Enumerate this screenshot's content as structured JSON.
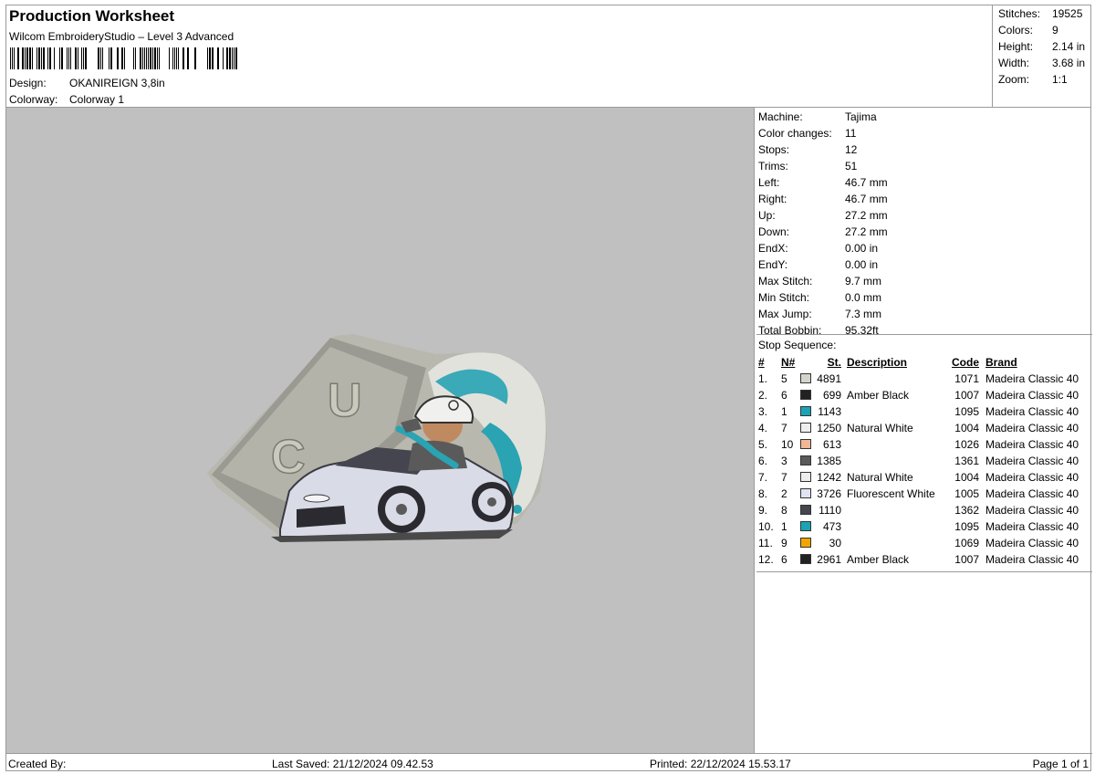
{
  "header": {
    "title": "Production Worksheet",
    "subtitle": "Wilcom EmbroideryStudio – Level 3 Advanced",
    "design_label": "Design:",
    "design_value": "OKANIREIGN 3,8in",
    "colorway_label": "Colorway:",
    "colorway_value": "Colorway 1"
  },
  "summary": [
    {
      "label": "Stitches:",
      "value": "19525"
    },
    {
      "label": "Colors:",
      "value": "9"
    },
    {
      "label": "Height:",
      "value": "2.14 in"
    },
    {
      "label": "Width:",
      "value": "3.68 in"
    },
    {
      "label": "Zoom:",
      "value": "1:1"
    }
  ],
  "machine_info": [
    {
      "label": "Machine:",
      "value": "Tajima"
    },
    {
      "label": "Color changes:",
      "value": "11"
    },
    {
      "label": "Stops:",
      "value": "12"
    },
    {
      "label": "Trims:",
      "value": "51"
    },
    {
      "label": "Left:",
      "value": "46.7 mm"
    },
    {
      "label": "Right:",
      "value": "46.7 mm"
    },
    {
      "label": "Up:",
      "value": "27.2 mm"
    },
    {
      "label": "Down:",
      "value": "27.2 mm"
    },
    {
      "label": "EndX:",
      "value": "0.00 in"
    },
    {
      "label": "EndY:",
      "value": "0.00 in"
    },
    {
      "label": "Max Stitch:",
      "value": "9.7 mm"
    },
    {
      "label": "Min Stitch:",
      "value": "0.0 mm"
    },
    {
      "label": "Max Jump:",
      "value": "7.3 mm"
    },
    {
      "label": "Total Bobbin:",
      "value": "95.32ft"
    }
  ],
  "stop_sequence": {
    "title": "Stop Sequence:",
    "columns": {
      "idx": "#",
      "needle": "N#",
      "stitches": "St.",
      "description": "Description",
      "code": "Code",
      "brand": "Brand"
    },
    "rows": [
      {
        "idx": "1.",
        "needle": "5",
        "color": "#d4d4cc",
        "stitches": "4891",
        "description": "",
        "code": "1071",
        "brand": "Madeira Classic 40"
      },
      {
        "idx": "2.",
        "needle": "6",
        "color": "#222222",
        "stitches": "699",
        "description": "Amber Black",
        "code": "1007",
        "brand": "Madeira Classic 40"
      },
      {
        "idx": "3.",
        "needle": "1",
        "color": "#1ba3b3",
        "stitches": "1143",
        "description": "",
        "code": "1095",
        "brand": "Madeira Classic 40"
      },
      {
        "idx": "4.",
        "needle": "7",
        "color": "#eeeeee",
        "stitches": "1250",
        "description": "Natural White",
        "code": "1004",
        "brand": "Madeira Classic 40"
      },
      {
        "idx": "5.",
        "needle": "10",
        "color": "#f0b795",
        "stitches": "613",
        "description": "",
        "code": "1026",
        "brand": "Madeira Classic 40"
      },
      {
        "idx": "6.",
        "needle": "3",
        "color": "#5a5a5a",
        "stitches": "1385",
        "description": "",
        "code": "1361",
        "brand": "Madeira Classic 40"
      },
      {
        "idx": "7.",
        "needle": "7",
        "color": "#eeeeee",
        "stitches": "1242",
        "description": "Natural White",
        "code": "1004",
        "brand": "Madeira Classic 40"
      },
      {
        "idx": "8.",
        "needle": "2",
        "color": "#dfe3f3",
        "stitches": "3726",
        "description": "Fluorescent White",
        "code": "1005",
        "brand": "Madeira Classic 40"
      },
      {
        "idx": "9.",
        "needle": "8",
        "color": "#45454f",
        "stitches": "1110",
        "description": "",
        "code": "1362",
        "brand": "Madeira Classic 40"
      },
      {
        "idx": "10.",
        "needle": "1",
        "color": "#1ba3b3",
        "stitches": "473",
        "description": "",
        "code": "1095",
        "brand": "Madeira Classic 40"
      },
      {
        "idx": "11.",
        "needle": "9",
        "color": "#f0a500",
        "stitches": "30",
        "description": "",
        "code": "1069",
        "brand": "Madeira Classic 40"
      },
      {
        "idx": "12.",
        "needle": "6",
        "color": "#222222",
        "stitches": "2961",
        "description": "Amber Black",
        "code": "1007",
        "brand": "Madeira Classic 40"
      }
    ]
  },
  "footer": {
    "created_by": "Created By:",
    "last_saved": "Last Saved: 21/12/2024 09.42.53",
    "printed": "Printed: 22/12/2024 15.53.17",
    "page": "Page 1 of 1"
  },
  "design_preview": {
    "letters": [
      "U",
      "C"
    ]
  }
}
